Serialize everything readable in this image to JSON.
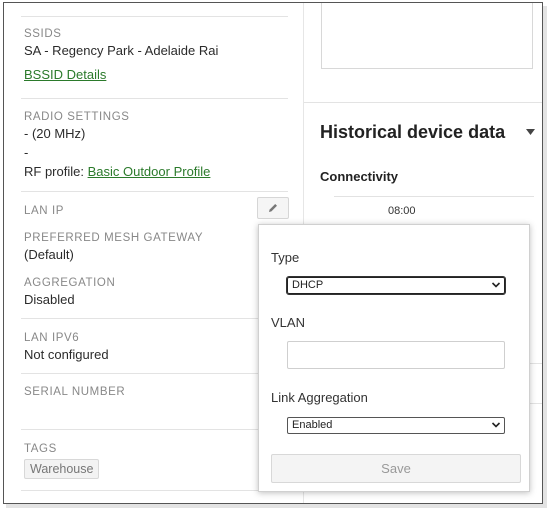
{
  "details": {
    "ssids": {
      "label": "SSIDS",
      "value": "SA - Regency Park - Adelaide Rai",
      "link": "BSSID Details"
    },
    "radio": {
      "label": "RADIO SETTINGS",
      "line1": "- (20 MHz)",
      "line2": "-",
      "rf_prefix": "RF profile: ",
      "rf_link": "Basic Outdoor Profile"
    },
    "lan_ip": {
      "label": "LAN IP"
    },
    "mesh": {
      "label": "PREFERRED MESH GATEWAY",
      "value": "(Default)"
    },
    "aggregation": {
      "label": "AGGREGATION",
      "value": "Disabled"
    },
    "lan_ipv6": {
      "label": "LAN IPV6",
      "value": "Not configured"
    },
    "serial": {
      "label": "SERIAL NUMBER",
      "value": ""
    },
    "tags": {
      "label": "TAGS",
      "items": [
        "Warehouse"
      ]
    }
  },
  "right": {
    "title": "Historical device data",
    "section": "Connectivity",
    "time_tick": "08:00"
  },
  "popover": {
    "type_label": "Type",
    "type_value": "DHCP",
    "vlan_label": "VLAN",
    "vlan_value": "",
    "link_agg_label": "Link Aggregation",
    "link_agg_value": "Enabled",
    "save_label": "Save"
  },
  "icons": {
    "edit": "pencil-icon",
    "dropdown": "chevron-down-icon",
    "title_caret": "caret-down-icon"
  },
  "colors": {
    "link": "#2b7a2b",
    "label": "#888888",
    "border": "#d0d0d0"
  }
}
